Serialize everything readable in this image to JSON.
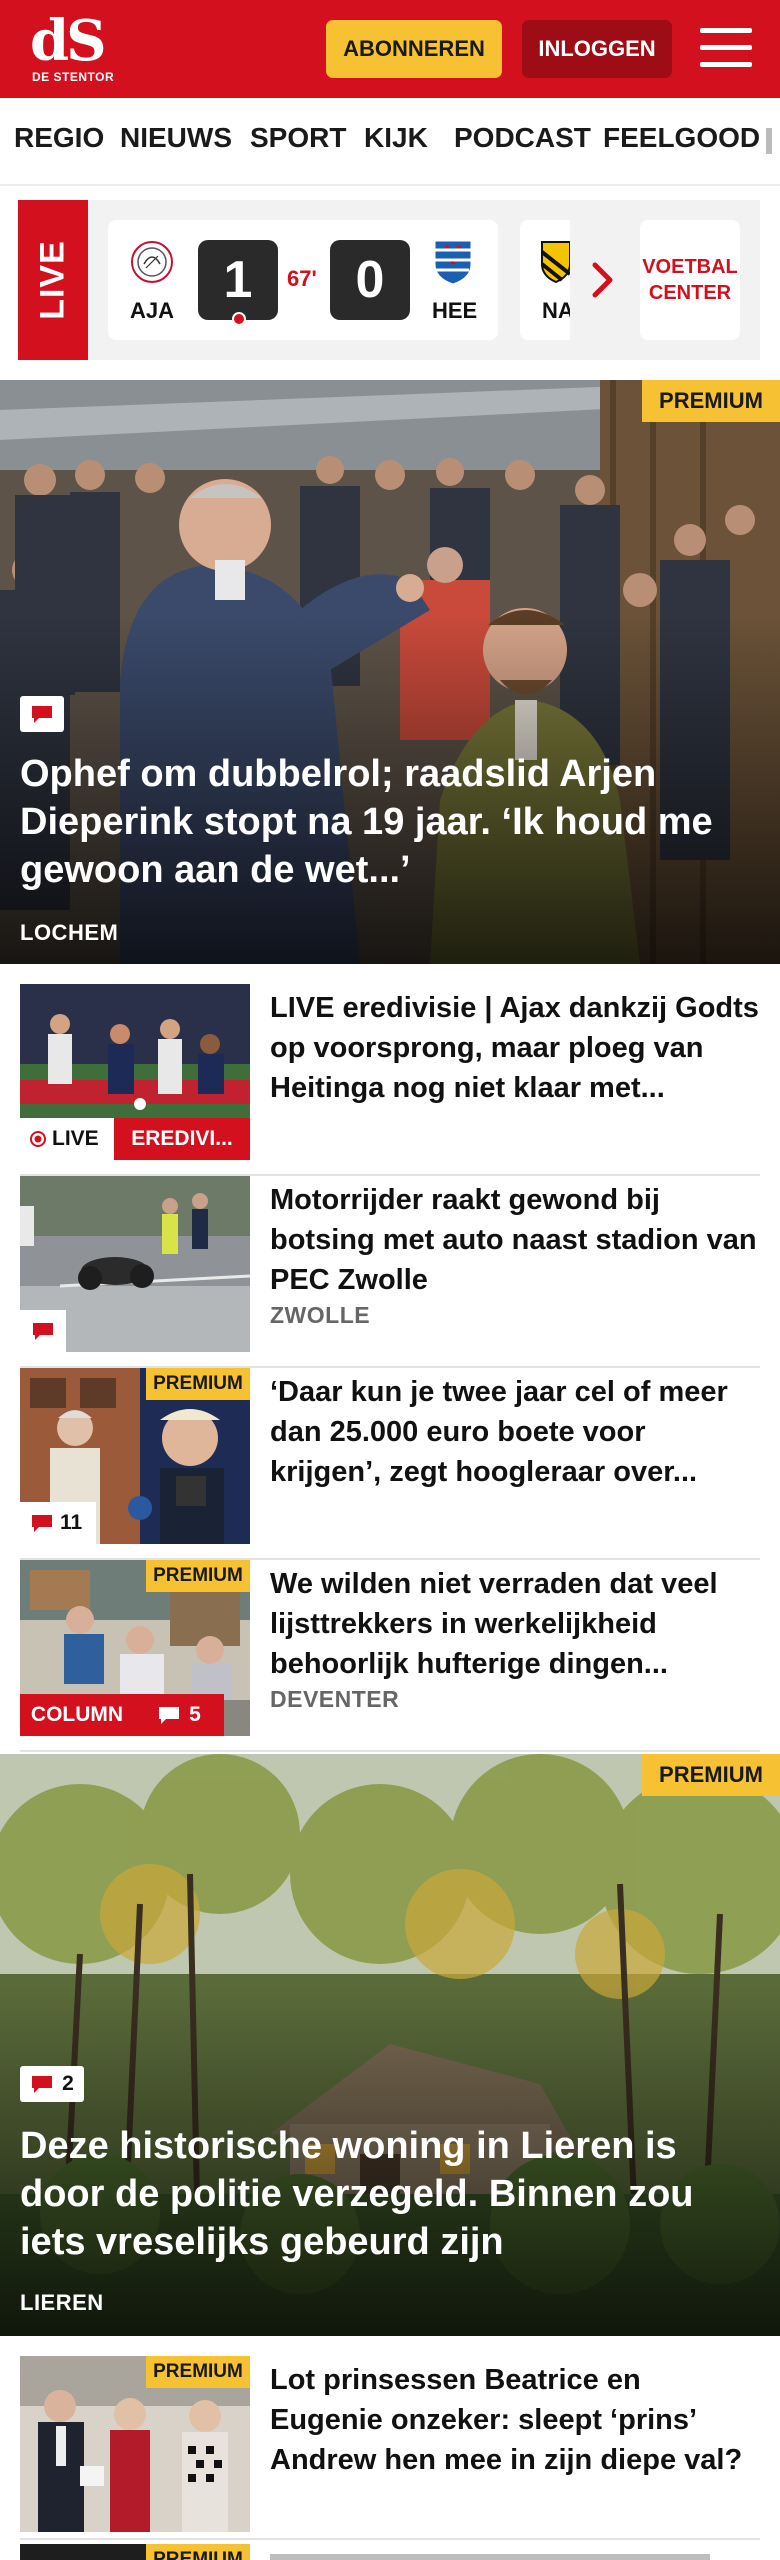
{
  "header": {
    "logo_text": "dS",
    "logo_sub": "DE STENTOR",
    "subscribe_label": "ABONNEREN",
    "login_label": "INLOGGEN",
    "brand_color": "#d2101e",
    "accent_color": "#f6c233"
  },
  "nav": {
    "items": [
      "REGIO",
      "NIEUWS",
      "SPORT",
      "KIJK",
      "PODCAST",
      "FEELGOOD"
    ]
  },
  "live": {
    "label": "LIVE",
    "match": {
      "home": "AJA",
      "away": "HEE",
      "home_score": "1",
      "away_score": "0",
      "minute": "67'"
    },
    "next_team": "NA",
    "voetbal_center_line1": "VOETBAL",
    "voetbal_center_line2": "CENTER"
  },
  "hero1": {
    "premium": "PREMIUM",
    "title": "Ophef om dubbelrol; raadslid Arjen Dieperink stopt na 19 jaar. ‘Ik houd me gewoon aan de wet...’",
    "location": "LOCHEM"
  },
  "articles": [
    {
      "title": "LIVE eredivisie | Ajax dankzij Godts op voorsprong, maar ploeg van Heitinga nog niet klaar met...",
      "live_label": "LIVE",
      "tag": "EREDIVI..."
    },
    {
      "title": "Motorrijder raakt gewond bij botsing met auto naast stadion van PEC Zwolle",
      "location": "ZWOLLE"
    },
    {
      "title": "‘Daar kun je twee jaar cel of meer dan 25.000 euro boete voor krijgen’, zegt hoogleraar over...",
      "premium": "PREMIUM",
      "comments": "11"
    },
    {
      "title": "We wilden niet verraden dat veel lijsttrekkers in werkelijkheid behoorlijk hufterige dingen...",
      "premium": "PREMIUM",
      "tag": "COLUMN",
      "comments": "5",
      "location": "DEVENTER"
    }
  ],
  "hero2": {
    "premium": "PREMIUM",
    "comments": "2",
    "title": "Deze historische woning in Lieren is door de politie verzegeld. Binnen zou iets vreselijks gebeurd zijn",
    "location": "LIEREN"
  },
  "article_last": {
    "premium": "PREMIUM",
    "title": "Lot prinsessen Beatrice en Eugenie onzeker: sleept ‘prins’ Andrew hen mee in zijn diepe val?"
  },
  "article_cut": {
    "premium": "PREMIUM"
  }
}
